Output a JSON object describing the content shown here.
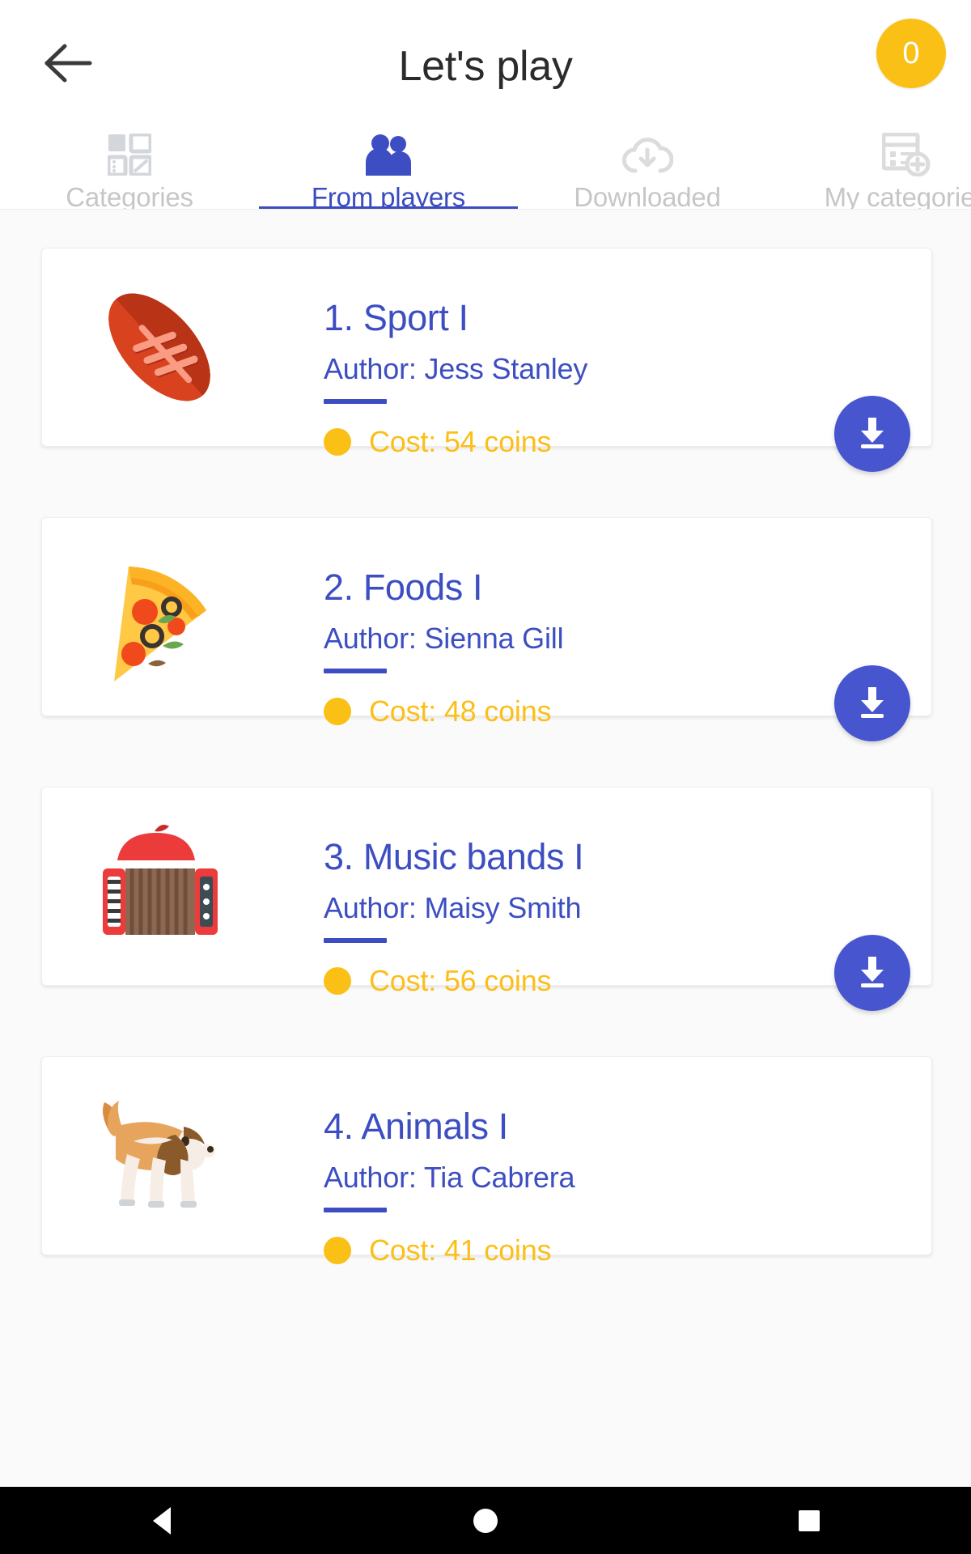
{
  "header": {
    "back_icon": "arrow-left-icon",
    "title": "Let's play",
    "coins": "0",
    "coin_color": "#fac016"
  },
  "tabs": [
    {
      "label": "Categories",
      "icon": "grid-categories-icon",
      "active": false
    },
    {
      "label": "From players",
      "icon": "people-icon",
      "active": true
    },
    {
      "label": "Downloaded",
      "icon": "cloud-download-icon",
      "active": false
    },
    {
      "label": "My categories",
      "icon": "add-list-icon",
      "active": false
    }
  ],
  "accent_color": "#3c4ec2",
  "cards": [
    {
      "title": "1. Sport I",
      "author": "Author: Jess Stanley",
      "cost": "Cost: 54 coins",
      "thumb": "american-football-icon",
      "download_icon": "download-icon"
    },
    {
      "title": "2. Foods I",
      "author": "Author: Sienna Gill",
      "cost": "Cost: 48 coins",
      "thumb": "pizza-slice-icon",
      "download_icon": "download-icon"
    },
    {
      "title": "3. Music bands I",
      "author": "Author: Maisy Smith",
      "cost": "Cost: 56 coins",
      "thumb": "accordion-beret-icon",
      "download_icon": "download-icon"
    },
    {
      "title": "4. Animals I",
      "author": "Author: Tia Cabrera",
      "cost": "Cost: 41 coins",
      "thumb": "beagle-dog-icon",
      "download_icon": "download-icon"
    }
  ],
  "navbar": {
    "back": "nav-back-icon",
    "home": "nav-home-icon",
    "recent": "nav-recents-icon"
  }
}
